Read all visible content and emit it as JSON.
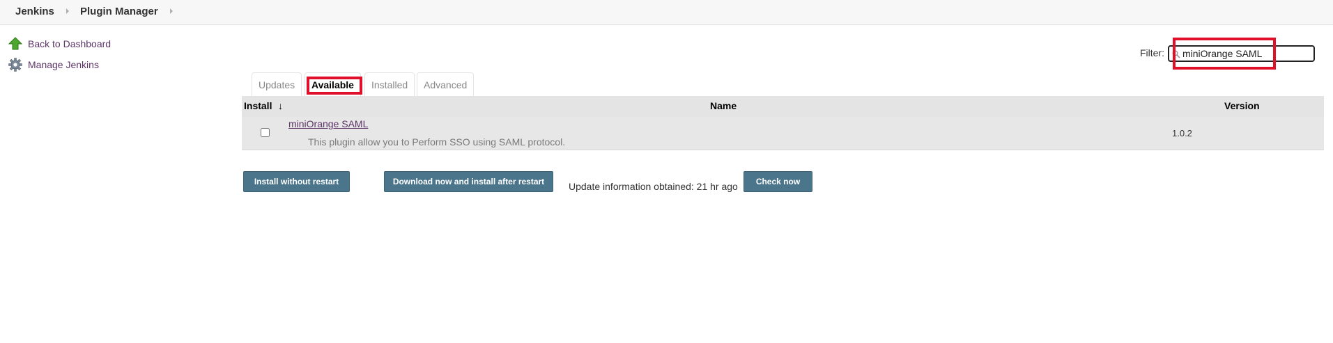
{
  "breadcrumb": {
    "items": [
      "Jenkins",
      "Plugin Manager"
    ]
  },
  "side_panel": {
    "items": [
      {
        "label": "Back to Dashboard",
        "icon": "up-arrow-icon"
      },
      {
        "label": "Manage Jenkins",
        "icon": "gear-icon"
      }
    ]
  },
  "filter": {
    "label": "Filter:",
    "value": "miniOrange SAML",
    "icon": "search-icon"
  },
  "tabs": [
    {
      "label": "Updates",
      "active": false
    },
    {
      "label": "Available",
      "active": true
    },
    {
      "label": "Installed",
      "active": false
    },
    {
      "label": "Advanced",
      "active": false
    }
  ],
  "table": {
    "headers": {
      "install": "Install",
      "sort_indicator": "↓",
      "name": "Name",
      "version": "Version"
    },
    "rows": [
      {
        "checked": false,
        "name": "miniOrange SAML",
        "description": "This plugin allow you to Perform SSO using SAML protocol.",
        "version": "1.0.2"
      }
    ]
  },
  "actions": {
    "install_without_restart": "Install without restart",
    "download_install_after_restart": "Download now and install after restart",
    "update_info": "Update information obtained: 21 hr ago",
    "check_now": "Check now"
  },
  "colors": {
    "button_bg": "#4b758b",
    "link": "#5c3566",
    "highlight": "#e0102a",
    "table_row_bg": "#e7e7e7"
  }
}
